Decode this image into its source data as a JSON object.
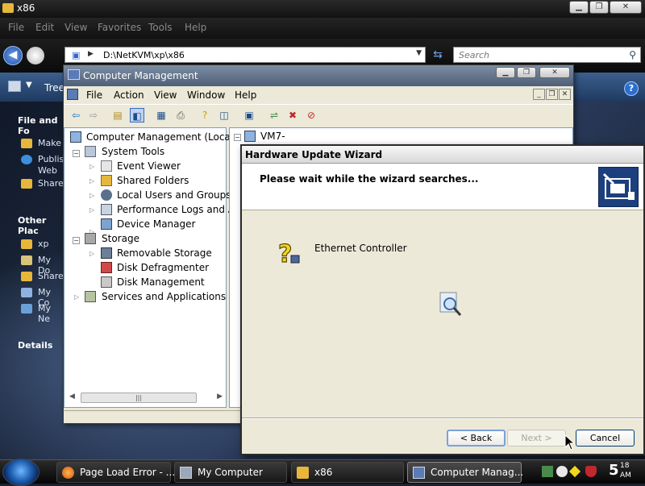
{
  "explorer": {
    "title": "x86",
    "menu": [
      "File",
      "Edit",
      "View",
      "Favorites",
      "Tools",
      "Help"
    ],
    "address": "D:\\NetKVM\\xp\\x86",
    "search_placeholder": "Search",
    "toolbar_label": "Tree",
    "tasks": {
      "file_heading": "File and Fo",
      "file_items": [
        "Make",
        "Publis",
        "Web",
        "Share"
      ],
      "other_heading": "Other Plac",
      "other_items": [
        "xp",
        "My Do",
        "Share",
        "My Co",
        "My Ne"
      ],
      "details_heading": "Details"
    }
  },
  "computer_management": {
    "title": "Computer Management",
    "menu": [
      "File",
      "Action",
      "View",
      "Window",
      "Help"
    ],
    "tree": {
      "root": "Computer Management (Local)",
      "system_tools": "System Tools",
      "event_viewer": "Event Viewer",
      "shared_folders": "Shared Folders",
      "local_users": "Local Users and Groups",
      "perf_logs": "Performance Logs and Al",
      "device_manager": "Device Manager",
      "storage": "Storage",
      "removable_storage": "Removable Storage",
      "disk_defrag": "Disk Defragmenter",
      "disk_mgmt": "Disk Management",
      "services": "Services and Applications"
    },
    "right_root": "VM7-"
  },
  "wizard": {
    "title": "Hardware Update Wizard",
    "heading": "Please wait while the wizard searches...",
    "device": "Ethernet Controller",
    "back_label": "< Back",
    "next_label": "Next >",
    "cancel_label": "Cancel"
  },
  "taskbar": {
    "tasks": [
      "Page Load Error - ...",
      "My Computer",
      "x86",
      "Computer Manag..."
    ],
    "clock_hour": "5",
    "clock_minutes": "18",
    "clock_ampm": "AM"
  },
  "colors": {
    "accent": "#1f5fb0",
    "wizard_header_icon": "#1c3f7e"
  }
}
